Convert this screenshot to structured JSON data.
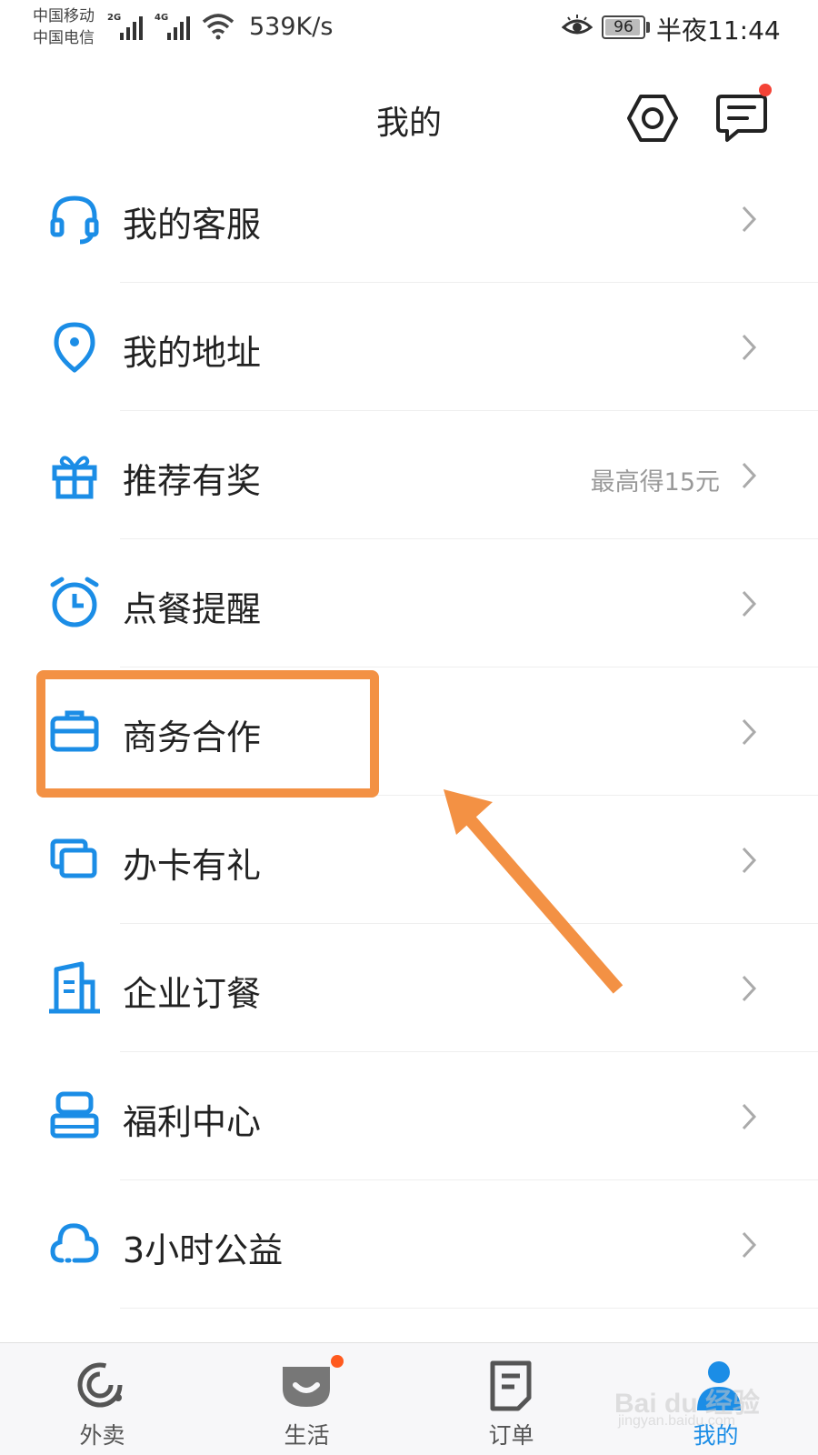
{
  "status_bar": {
    "carrier_1": "中国移动",
    "carrier_2": "中国电信",
    "net_1": "2G",
    "net_2": "4G",
    "speed": "539K/s",
    "battery": "96",
    "battery_level": 0.96,
    "time": "半夜11:44"
  },
  "header": {
    "title": "我的",
    "settings_icon": "settings-hexagon-icon",
    "message_icon": "message-icon",
    "message_badge_color": "#F44336"
  },
  "menu": {
    "items": [
      {
        "label": "我的客服",
        "icon": "headset-icon",
        "extra": ""
      },
      {
        "label": "我的地址",
        "icon": "location-pin-icon",
        "extra": ""
      },
      {
        "label": "推荐有奖",
        "icon": "gift-icon",
        "extra": "最高得15元"
      },
      {
        "label": "点餐提醒",
        "icon": "alarm-clock-icon",
        "extra": ""
      },
      {
        "label": "商务合作",
        "icon": "briefcase-icon",
        "extra": ""
      },
      {
        "label": "办卡有礼",
        "icon": "cards-icon",
        "extra": ""
      },
      {
        "label": "企业订餐",
        "icon": "building-icon",
        "extra": ""
      },
      {
        "label": "福利中心",
        "icon": "welfare-box-icon",
        "extra": ""
      },
      {
        "label": "3小时公益",
        "icon": "cloud-icon",
        "extra": ""
      }
    ]
  },
  "tab_bar": {
    "tabs": [
      {
        "label": "外卖",
        "icon": "eleme-logo-icon",
        "active": false
      },
      {
        "label": "生活",
        "icon": "life-smile-icon",
        "active": false
      },
      {
        "label": "订单",
        "icon": "order-document-icon",
        "active": false
      },
      {
        "label": "我的",
        "icon": "profile-icon",
        "active": true
      }
    ],
    "badge_color": "#FF5A1F"
  },
  "watermark": {
    "main": "Bai du 经验",
    "sub": "jingyan.baidu.com"
  },
  "colors": {
    "accent_blue": "#1B8DE6",
    "annotation_orange": "#F39144"
  }
}
